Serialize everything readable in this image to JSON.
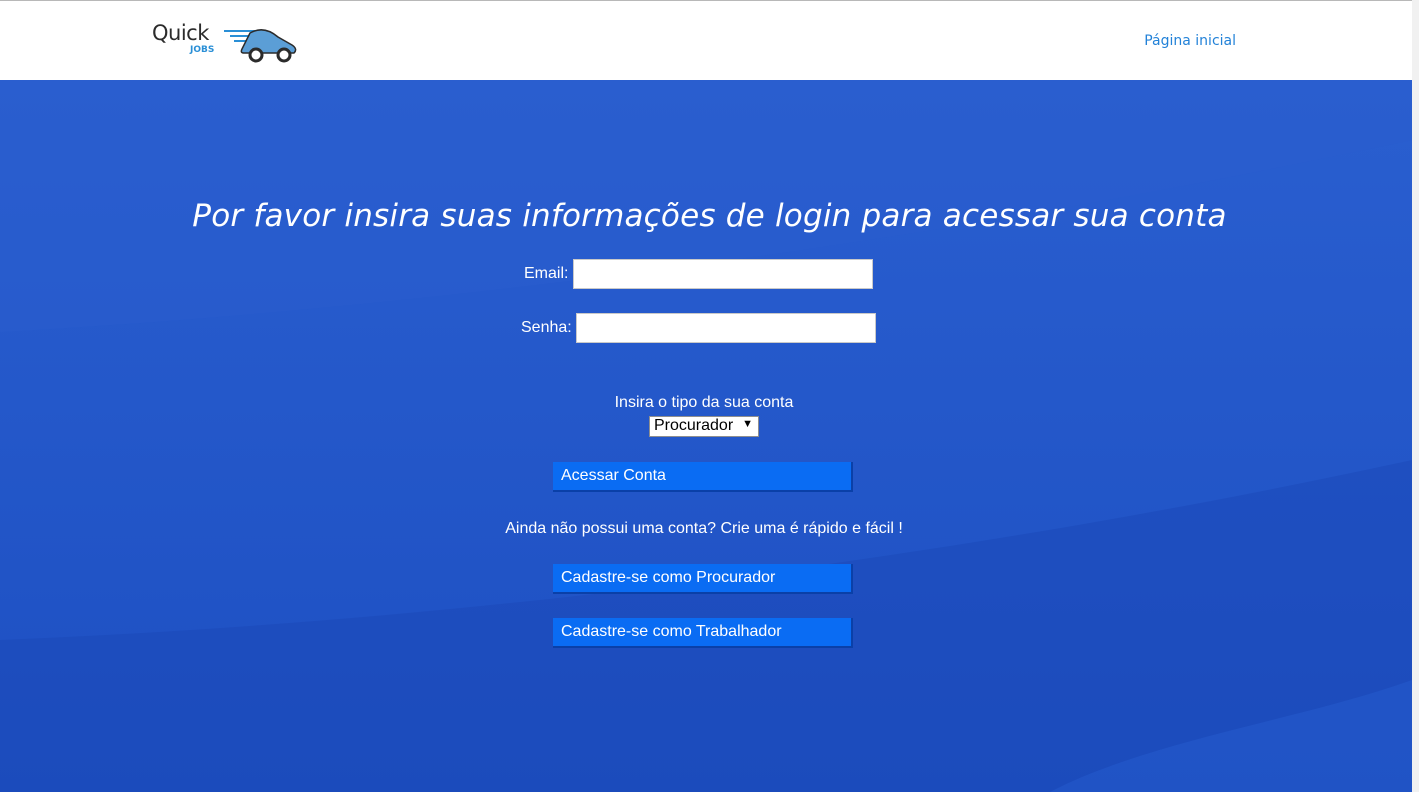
{
  "header": {
    "logo": {
      "word": "Quick",
      "sub": "JOBS",
      "icon": "truck-icon"
    },
    "nav_home": "Página inicial"
  },
  "login": {
    "heading": "Por favor insira suas informações de login para acessar sua conta",
    "email_label": "Email:",
    "email_value": "",
    "password_label": "Senha:",
    "password_value": "",
    "account_type_label": "Insira o tipo da sua conta",
    "account_type_selected": "Procurador",
    "submit_label": "Acessar Conta"
  },
  "signup": {
    "prompt": "Ainda não possui uma conta? Crie uma é rápido e fácil !",
    "procurador_button": "Cadastre-se como Procurador",
    "trabalhador_button": "Cadastre-se como Trabalhador"
  },
  "colors": {
    "background": "#1e4fc0",
    "button": "#0a6cf3",
    "link": "#2382d8"
  }
}
